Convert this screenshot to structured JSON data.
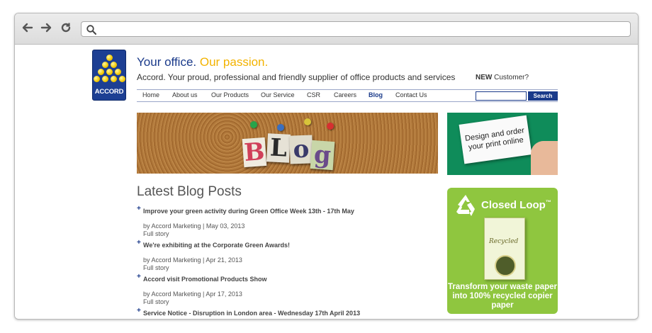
{
  "browser": {
    "url": "",
    "icons": {
      "back": "arrow-left-icon",
      "forward": "arrow-right-icon",
      "reload": "reload-icon",
      "search": "search-icon"
    }
  },
  "header": {
    "logo_text": "ACCORD",
    "tagline_part1": "Your office.",
    "tagline_part2": "Our passion.",
    "subline": "Accord. Your proud, professional and friendly supplier of office products and services",
    "new_customer_bold": "NEW",
    "new_customer_rest": "Customer?"
  },
  "nav": {
    "items": [
      {
        "label": "Home"
      },
      {
        "label": "About us"
      },
      {
        "label": "Our Products"
      },
      {
        "label": "Our Service"
      },
      {
        "label": "CSR"
      },
      {
        "label": "Careers"
      },
      {
        "label": "Blog"
      },
      {
        "label": "Contact Us"
      }
    ],
    "active": "Blog",
    "search_value": "",
    "search_button": "Search"
  },
  "banner": {
    "letters": [
      "B",
      "L",
      "o",
      "g"
    ]
  },
  "blog": {
    "heading": "Latest Blog Posts",
    "posts": [
      {
        "title": "Improve your green activity during Green Office Week 13th - 17th May",
        "meta": "by Accord Marketing | May 03, 2013",
        "more": "Full story"
      },
      {
        "title": "We're exhibiting at the Corporate Green Awards!",
        "meta": "by Accord Marketing | Apr 21, 2013",
        "more": "Full story"
      },
      {
        "title": "Accord visit Promotional Products Show",
        "meta": "by Accord Marketing | Apr 17, 2013",
        "more": "Full story"
      },
      {
        "title": "Service Notice - Disruption in London area - Wednesday 17th April 2013",
        "meta": "",
        "more": ""
      }
    ]
  },
  "sidebar": {
    "print_ad": "Design and order your print online",
    "closed_loop_title": "Closed Loop",
    "closed_loop_tm": "™",
    "ream_label": "Recycled",
    "closed_loop_text": "Transform your waste paper into 100% recycled copier paper"
  },
  "colors": {
    "brand_blue": "#1a3a8a",
    "brand_yellow": "#f3b300",
    "print_ad_green": "#0f8c5a",
    "closed_loop_green": "#8fc63f"
  }
}
